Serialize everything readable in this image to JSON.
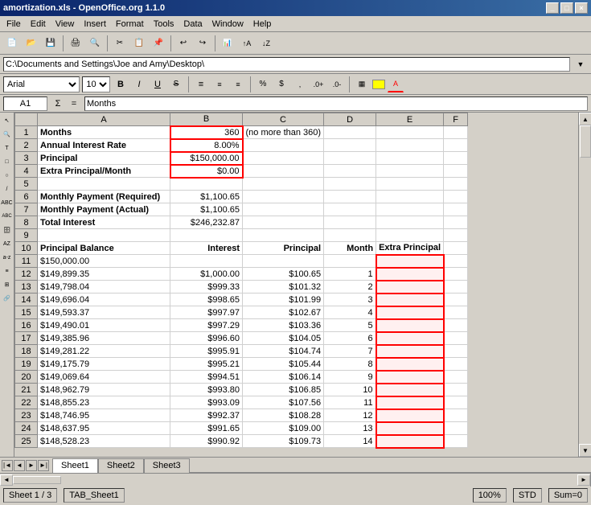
{
  "window": {
    "title": "amortization.xls - OpenOffice.org 1.1.0",
    "title_buttons": [
      "_",
      "□",
      "×"
    ]
  },
  "menu": {
    "items": [
      "File",
      "Edit",
      "View",
      "Insert",
      "Format",
      "Tools",
      "Data",
      "Window",
      "Help"
    ]
  },
  "path_bar": {
    "value": "C:\\Documents and Settings\\Joe and Amy\\Desktop\\"
  },
  "format_bar": {
    "font": "Arial",
    "size": "10",
    "bold": "B",
    "italic": "I",
    "underline": "U"
  },
  "formula_bar": {
    "cell_ref": "A1",
    "sigma": "Σ",
    "equals": "=",
    "value": "Months"
  },
  "columns": {
    "row_width": 28,
    "a_width": 165,
    "b_width": 90,
    "c_width": 80,
    "d_width": 65,
    "e_width": 80,
    "f_width": 30,
    "headers": [
      "",
      "A",
      "B",
      "C",
      "D",
      "E",
      "F"
    ]
  },
  "rows": [
    {
      "num": 1,
      "a": "Months",
      "b": "360",
      "c": "(no more than 360)",
      "d": "",
      "e": "",
      "f": "",
      "b_red": true
    },
    {
      "num": 2,
      "a": "Annual Interest Rate",
      "b": "8.00%",
      "c": "",
      "d": "",
      "e": "",
      "f": "",
      "b_red": true
    },
    {
      "num": 3,
      "a": "Principal",
      "b": "$150,000.00",
      "c": "",
      "d": "",
      "e": "",
      "f": "",
      "b_red": true
    },
    {
      "num": 4,
      "a": "Extra Principal/Month",
      "b": "$0.00",
      "c": "",
      "d": "",
      "e": "",
      "f": "",
      "b_red": true
    },
    {
      "num": 5,
      "a": "",
      "b": "",
      "c": "",
      "d": "",
      "e": "",
      "f": ""
    },
    {
      "num": 6,
      "a": "Monthly Payment (Required)",
      "b": "$1,100.65",
      "c": "",
      "d": "",
      "e": "",
      "f": ""
    },
    {
      "num": 7,
      "a": "Monthly Payment (Actual)",
      "b": "$1,100.65",
      "c": "",
      "d": "",
      "e": "",
      "f": ""
    },
    {
      "num": 8,
      "a": "Total Interest",
      "b": "$246,232.87",
      "c": "",
      "d": "",
      "e": "",
      "f": ""
    },
    {
      "num": 9,
      "a": "",
      "b": "",
      "c": "",
      "d": "",
      "e": "",
      "f": ""
    },
    {
      "num": 10,
      "a": "Principal Balance",
      "b": "Interest",
      "c": "Principal",
      "d": "Month",
      "e": "Extra Principal",
      "f": "",
      "header": true
    },
    {
      "num": 11,
      "a": "$150,000.00",
      "b": "",
      "c": "",
      "d": "",
      "e": "",
      "f": "",
      "e_red": true
    },
    {
      "num": 12,
      "a": "$149,899.35",
      "b": "$1,000.00",
      "c": "$100.65",
      "d": "1",
      "e": "",
      "f": "",
      "e_red": true
    },
    {
      "num": 13,
      "a": "$149,798.04",
      "b": "$999.33",
      "c": "$101.32",
      "d": "2",
      "e": "",
      "f": "",
      "e_red": true
    },
    {
      "num": 14,
      "a": "$149,696.04",
      "b": "$998.65",
      "c": "$101.99",
      "d": "3",
      "e": "",
      "f": "",
      "e_red": true
    },
    {
      "num": 15,
      "a": "$149,593.37",
      "b": "$997.97",
      "c": "$102.67",
      "d": "4",
      "e": "",
      "f": "",
      "e_red": true
    },
    {
      "num": 16,
      "a": "$149,490.01",
      "b": "$997.29",
      "c": "$103.36",
      "d": "5",
      "e": "",
      "f": "",
      "e_red": true
    },
    {
      "num": 17,
      "a": "$149,385.96",
      "b": "$996.60",
      "c": "$104.05",
      "d": "6",
      "e": "",
      "f": "",
      "e_red": true
    },
    {
      "num": 18,
      "a": "$149,281.22",
      "b": "$995.91",
      "c": "$104.74",
      "d": "7",
      "e": "",
      "f": "",
      "e_red": true
    },
    {
      "num": 19,
      "a": "$149,175.79",
      "b": "$995.21",
      "c": "$105.44",
      "d": "8",
      "e": "",
      "f": "",
      "e_red": true
    },
    {
      "num": 20,
      "a": "$149,069.64",
      "b": "$994.51",
      "c": "$106.14",
      "d": "9",
      "e": "",
      "f": "",
      "e_red": true
    },
    {
      "num": 21,
      "a": "$148,962.79",
      "b": "$993.80",
      "c": "$106.85",
      "d": "10",
      "e": "",
      "f": "",
      "e_red": true
    },
    {
      "num": 22,
      "a": "$148,855.23",
      "b": "$993.09",
      "c": "$107.56",
      "d": "11",
      "e": "",
      "f": "",
      "e_red": true
    },
    {
      "num": 23,
      "a": "$148,746.95",
      "b": "$992.37",
      "c": "$108.28",
      "d": "12",
      "e": "",
      "f": "",
      "e_red": true
    },
    {
      "num": 24,
      "a": "$148,637.95",
      "b": "$991.65",
      "c": "$109.00",
      "d": "13",
      "e": "",
      "f": "",
      "e_red": true
    },
    {
      "num": 25,
      "a": "$148,528.23",
      "b": "$990.92",
      "c": "$109.73",
      "d": "14",
      "e": "",
      "f": "",
      "e_red": true
    }
  ],
  "status_bar": {
    "sheet": "Sheet 1 / 3",
    "tab_name": "TAB_Sheet1",
    "zoom": "100%",
    "mode": "STD",
    "sum": "Sum=0"
  },
  "sheet_tabs": [
    "Sheet1",
    "Sheet2",
    "Sheet3"
  ],
  "active_tab": "Sheet1"
}
